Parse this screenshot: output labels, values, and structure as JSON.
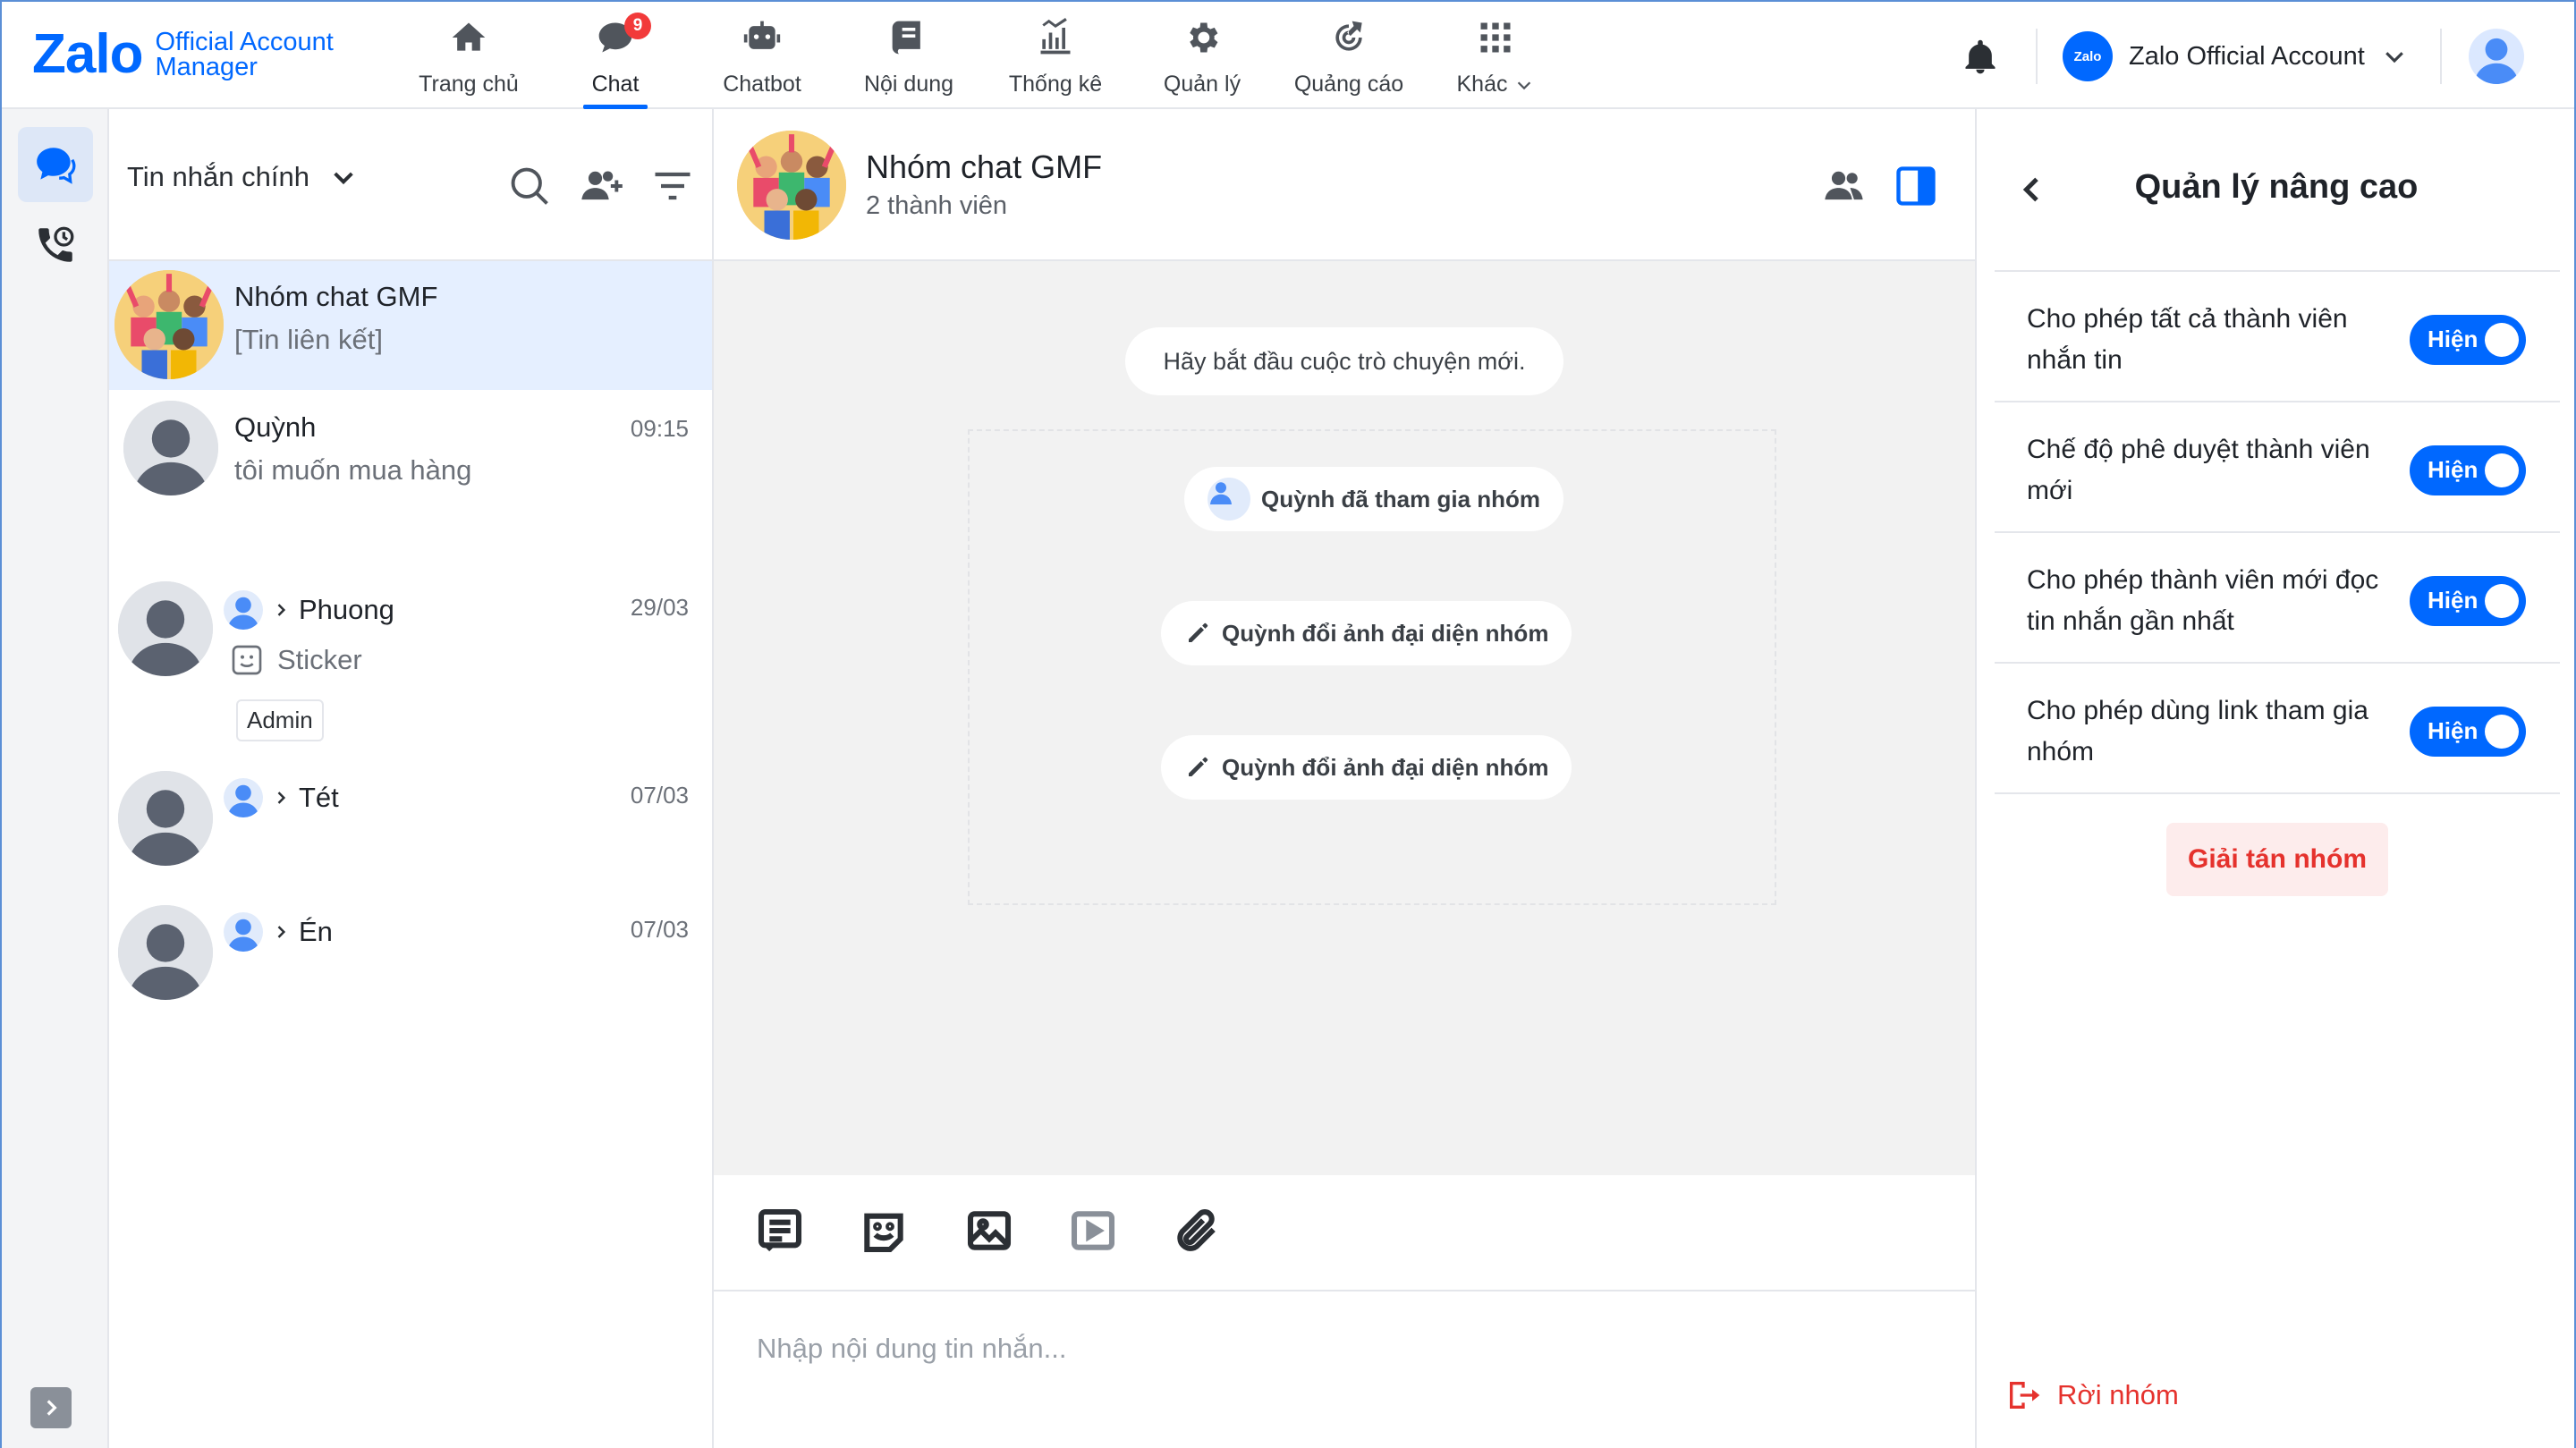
{
  "brand": {
    "name": "Zalo",
    "sub_line1": "Official Account",
    "sub_line2": "Manager"
  },
  "nav": [
    {
      "label": "Trang chủ",
      "icon": "home-icon"
    },
    {
      "label": "Chat",
      "icon": "chat-icon",
      "badge": "9",
      "active": true
    },
    {
      "label": "Chatbot",
      "icon": "chatbot-icon"
    },
    {
      "label": "Nội dung",
      "icon": "content-icon"
    },
    {
      "label": "Thống kê",
      "icon": "stats-icon"
    },
    {
      "label": "Quản lý",
      "icon": "gear-icon"
    },
    {
      "label": "Quảng cáo",
      "icon": "megaphone-icon"
    },
    {
      "label": "Khác",
      "icon": "grid-icon"
    }
  ],
  "account": {
    "logo_text": "Zalo",
    "name": "Zalo Official Account"
  },
  "conversation_list": {
    "folder": "Tin nhắn chính",
    "items": [
      {
        "name": "Nhóm chat GMF",
        "preview": "[Tin liên kết]",
        "time": ""
      },
      {
        "name": "Quỳnh",
        "preview": "tôi muốn mua hàng",
        "time": "09:15"
      },
      {
        "name": "Phuong",
        "preview": "Sticker",
        "time": "29/03",
        "tag": "Admin"
      },
      {
        "name": "Tét",
        "preview": "",
        "time": "07/03"
      },
      {
        "name": "Én",
        "preview": "",
        "time": "07/03"
      }
    ]
  },
  "chat": {
    "title": "Nhóm chat GMF",
    "subtitle": "2 thành viên",
    "start_notice": "Hãy bắt đầu cuộc trò chuyện mới.",
    "events": [
      "Quỳnh đã tham gia nhóm",
      "Quỳnh đổi ảnh đại diện nhóm",
      "Quỳnh đổi ảnh đại diện nhóm"
    ],
    "input_placeholder": "Nhập nội dung tin nhắn..."
  },
  "panel": {
    "title": "Quản lý nâng cao",
    "settings": [
      {
        "label": "Cho phép tất cả thành viên nhắn tin",
        "state": "Hiện"
      },
      {
        "label": "Chế độ phê duyệt thành viên mới",
        "state": "Hiện"
      },
      {
        "label": "Cho phép thành viên mới đọc tin nhắn gần nhất",
        "state": "Hiện"
      },
      {
        "label": "Cho phép dùng link tham gia nhóm",
        "state": "Hiện"
      }
    ],
    "disband_label": "Giải tán nhóm",
    "leave_label": "Rời nhóm"
  },
  "colors": {
    "accent": "#0068ff",
    "danger": "#e5322d",
    "selected_row": "#e5efff",
    "badge": "#f23a3a"
  }
}
